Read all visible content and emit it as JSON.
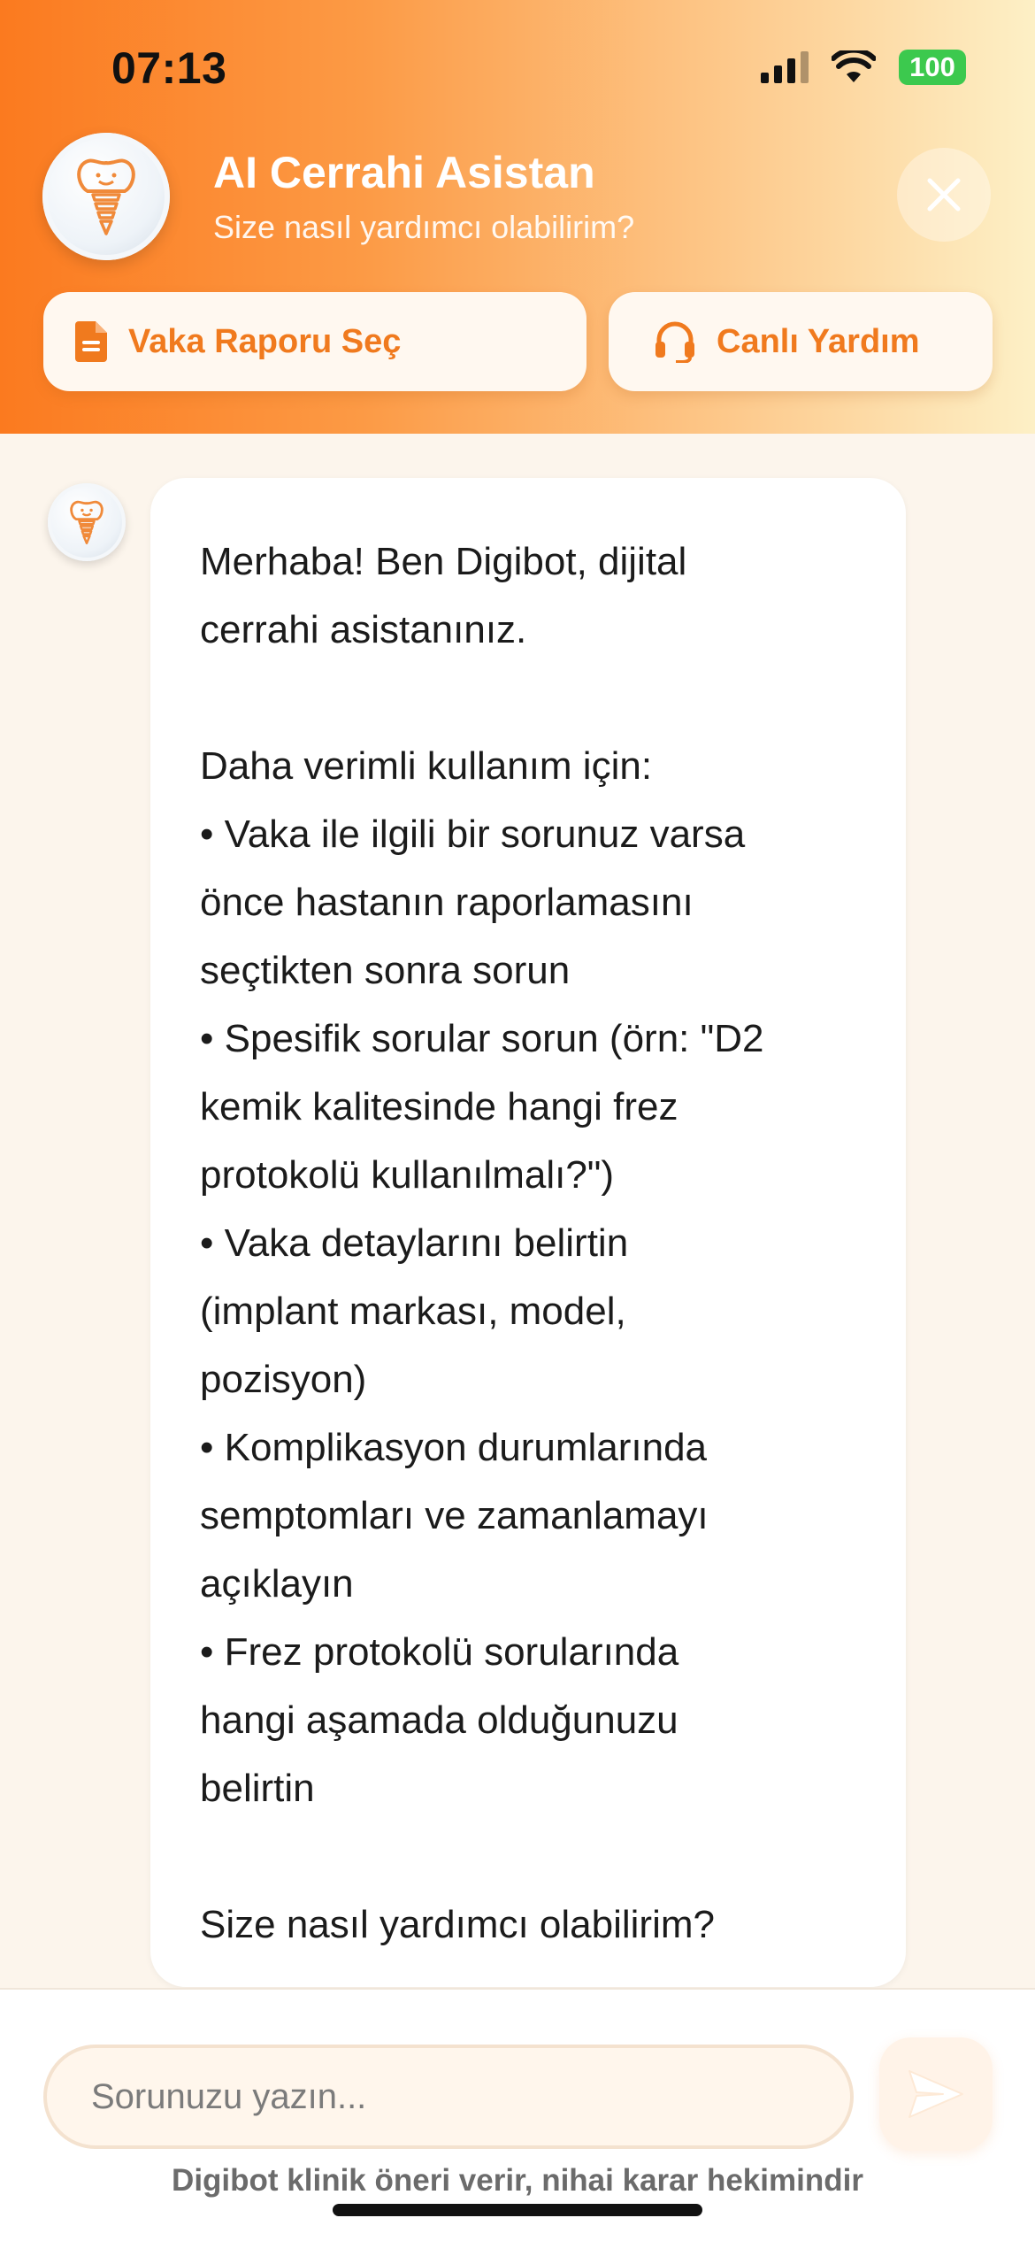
{
  "status_bar": {
    "time": "07:13",
    "battery": "100"
  },
  "header": {
    "title": "AI Cerrahi Asistan",
    "subtitle": "Size nasıl yardımcı olabilirim?",
    "report_button": "Vaka Raporu Seç",
    "live_help_button": "Canlı Yardım",
    "accent_color": "#f07a1e"
  },
  "chat": {
    "messages": [
      {
        "sender": "bot",
        "text": "Merhaba! Ben Digibot, dijital\ncerrahi asistanınız.\n\nDaha verimli kullanım için:\n• Vaka ile ilgili bir sorunuz varsa\nönce hastanın raporlamasını\nseçtikten sonra sorun\n• Spesifik sorular sorun (örn: \"D2\nkemik kalitesinde hangi frez\nprotokolü kullanılmalı?\")\n• Vaka detaylarını belirtin\n(implant markası, model,\npozisyon)\n• Komplikasyon durumlarında\nsemptomları ve zamanlamayı\naçıklayın\n• Frez protokolü sorularında\nhangi aşamada olduğunuzu\nbelirtin\n\nSize nasıl yardımcı olabilirim?"
      }
    ]
  },
  "composer": {
    "placeholder": "Sorunuzu yazın...",
    "disclaimer": "Digibot klinik öneri verir, nihai karar hekimindir"
  },
  "icons": {
    "close": "close-icon",
    "report": "document-icon",
    "live_help": "headset-icon",
    "send": "send-icon",
    "avatar": "tooth-implant-icon"
  }
}
